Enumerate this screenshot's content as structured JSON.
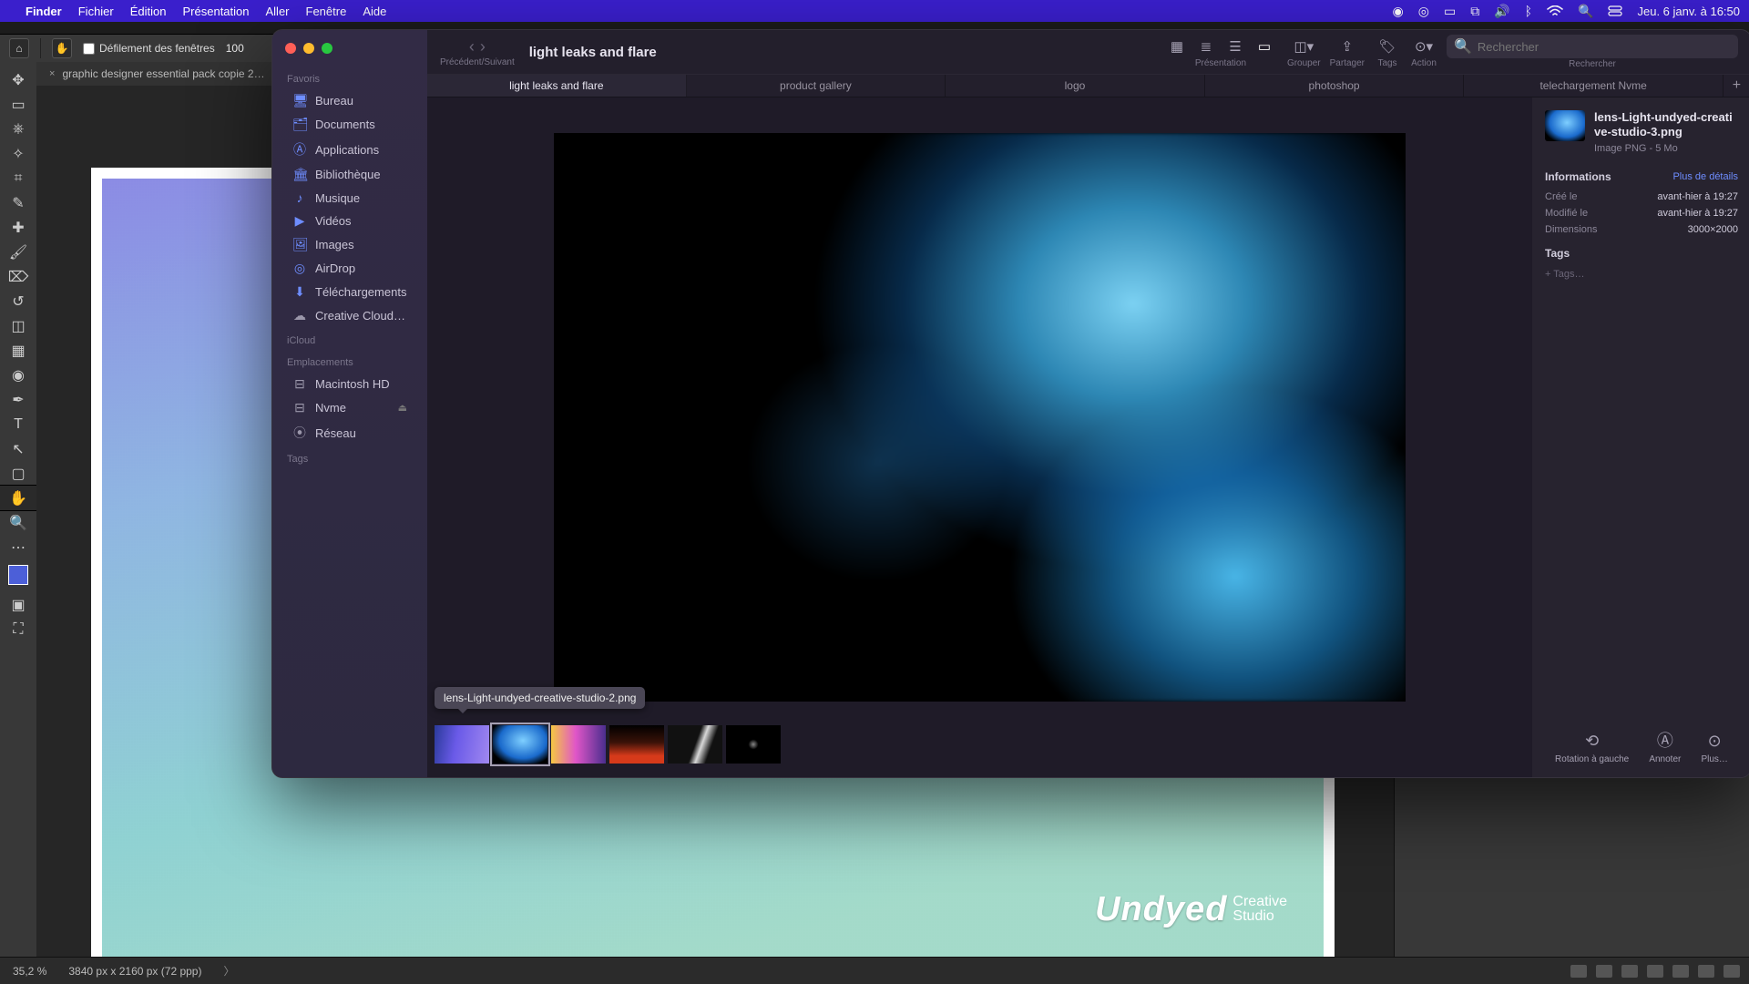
{
  "menubar": {
    "app": "Finder",
    "items": [
      "Fichier",
      "Édition",
      "Présentation",
      "Aller",
      "Fenêtre",
      "Aide"
    ],
    "datetime": "Jeu. 6 janv. à 16:50"
  },
  "photoshop": {
    "option_scroll": "Défilement des fenêtres",
    "option_zoom": "100",
    "file_tab": "graphic designer essential pack copie 2…",
    "status_zoom": "35,2 %",
    "status_dim": "3840 px x 2160 px (72 ppp)",
    "brand_main": "Undyed",
    "brand_l1": "Creative",
    "brand_l2": "Studio"
  },
  "finder": {
    "title": "light leaks and flare",
    "nav_label": "Précédent/Suivant",
    "view_label": "Présentation",
    "group_label": "Grouper",
    "share_label": "Partager",
    "tags_label": "Tags",
    "action_label": "Action",
    "search_placeholder": "Rechercher",
    "search_label": "Rechercher",
    "tabs": [
      "light leaks and flare",
      "product gallery",
      "logo",
      "photoshop",
      "telechargement Nvme"
    ],
    "active_tab": 0,
    "sidebar": {
      "favoris_head": "Favoris",
      "favoris": [
        "Bureau",
        "Documents",
        "Applications",
        "Bibliothèque",
        "Musique",
        "Vidéos",
        "Images",
        "AirDrop",
        "Téléchargements",
        "Creative Cloud…"
      ],
      "icloud_head": "iCloud",
      "emplacements_head": "Emplacements",
      "emplacements": [
        "Macintosh HD",
        "Nvme",
        "Réseau"
      ],
      "tags_head": "Tags"
    },
    "tooltip": "lens-Light-undyed-creative-studio-2.png",
    "info": {
      "filename": "lens-Light-undyed-creative-studio-3.png",
      "filetype": "Image PNG - 5 Mo",
      "section_info": "Informations",
      "more_details": "Plus de détails",
      "rows": [
        {
          "k": "Créé le",
          "v": "avant-hier à 19:27"
        },
        {
          "k": "Modifié le",
          "v": "avant-hier à 19:27"
        },
        {
          "k": "Dimensions",
          "v": "3000×2000"
        }
      ],
      "section_tags": "Tags",
      "add_tags": "+ Tags…",
      "actions": {
        "rotate": "Rotation à gauche",
        "annotate": "Annoter",
        "more": "Plus…"
      }
    }
  }
}
